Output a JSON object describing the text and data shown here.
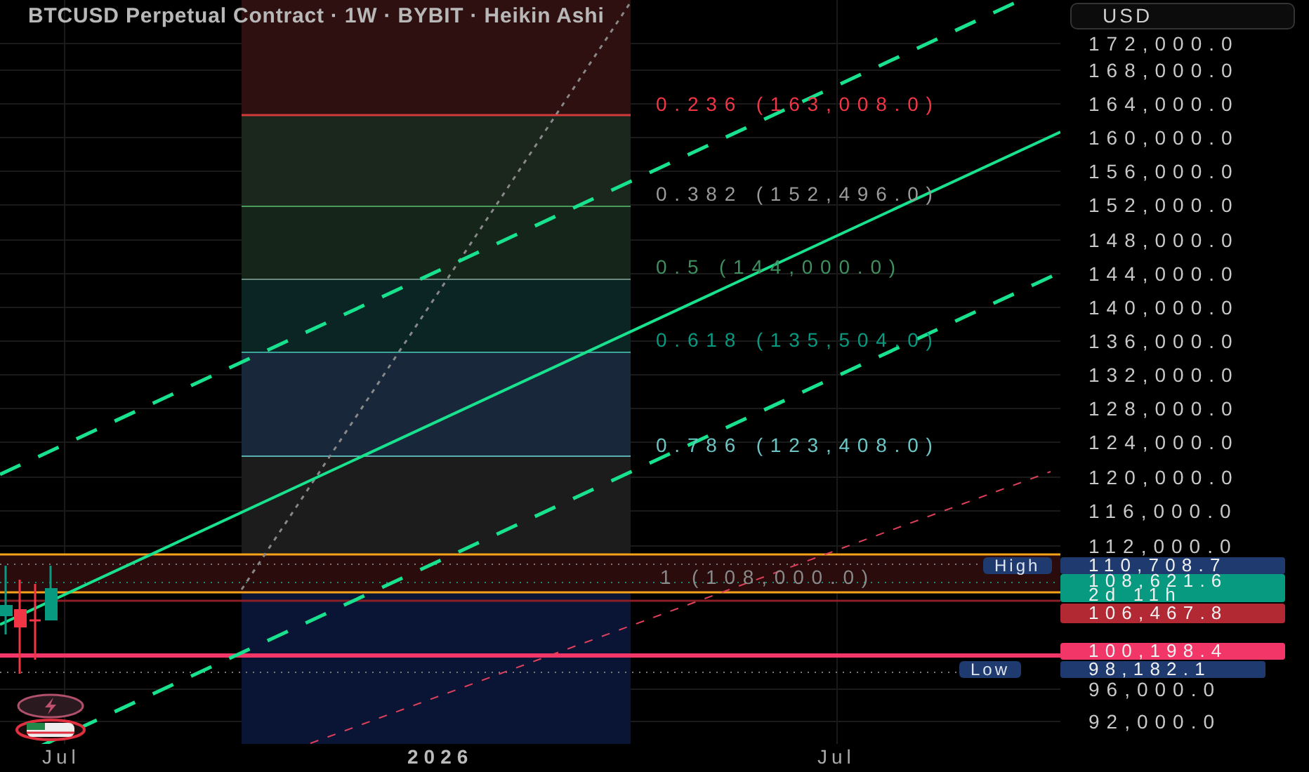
{
  "title": "BTCUSD Perpetual Contract · 1W · BYBIT · Heikin Ashi",
  "currency_button": "USD",
  "fib_levels": [
    {
      "label": "0.236 (163,008.0)",
      "color": "#f23645"
    },
    {
      "label": "0.382 (152,496.0)",
      "color": "#9a9a9a"
    },
    {
      "label": "0.5 (144,000.0)",
      "color": "#3f8f5f"
    },
    {
      "label": "0.618 (135,504.0)",
      "color": "#089981"
    },
    {
      "label": "0.786 (123,408.0)",
      "color": "#6cc6c6"
    },
    {
      "label": "1 (108,000.0)",
      "color": "#8a8a8a"
    }
  ],
  "price_ticks": [
    "172,000.0",
    "168,000.0",
    "164,000.0",
    "160,000.0",
    "156,000.0",
    "152,000.0",
    "148,000.0",
    "144,000.0",
    "140,000.0",
    "136,000.0",
    "132,000.0",
    "128,000.0",
    "124,000.0",
    "120,000.0",
    "116,000.0",
    "112,000.0",
    "96,000.0",
    "92,000.0"
  ],
  "price_tags": [
    {
      "kind": "marker",
      "label": "High",
      "value": "110,708.7",
      "color": "#1e3a6e"
    },
    {
      "kind": "countdown",
      "value": "108,621.6",
      "countdown": "2d 11h",
      "color": "#089981"
    },
    {
      "kind": "plain",
      "value": "106,467.8",
      "color": "#b22833"
    },
    {
      "kind": "plain",
      "value": "100,198.4",
      "color": "#f23667"
    },
    {
      "kind": "marker",
      "label": "Low",
      "value": "98,182.1",
      "color": "#1e3a6e"
    }
  ],
  "time_labels": [
    {
      "label": "Jul",
      "bold": false
    },
    {
      "label": "2026",
      "bold": true
    },
    {
      "label": "Jul",
      "bold": false
    }
  ]
}
